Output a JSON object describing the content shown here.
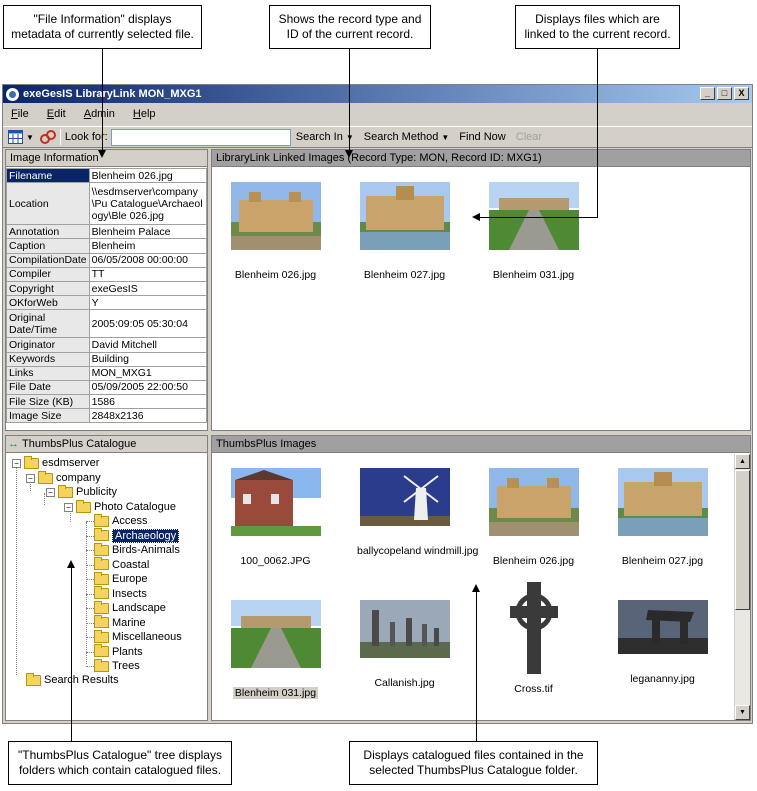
{
  "callouts": {
    "file_info": "\"File Information\" displays metadata of currently selected file.",
    "record_type": "Shows the record type and ID of the current record.",
    "linked_files": "Displays files which are linked to the current record.",
    "catalogue_tree": "\"ThumbsPlus Catalogue\" tree displays folders which contain catalogued files.",
    "catalogued_files": "Displays catalogued files contained in the selected ThumbsPlus Catalogue folder."
  },
  "window": {
    "title": "exeGesIS LibraryLink MON_MXG1",
    "buttons": [
      "_",
      "□",
      "X"
    ]
  },
  "menu": [
    "File",
    "Edit",
    "Admin",
    "Help"
  ],
  "toolbar": {
    "look_for_label": "Look for:",
    "look_for_value": "",
    "search_in": "Search In",
    "search_method": "Search Method",
    "find_now": "Find Now",
    "clear": "Clear"
  },
  "image_info": {
    "header": "Image Information",
    "rows": [
      {
        "key": "Filename",
        "value": "Blenheim 026.jpg"
      },
      {
        "key": "Location",
        "value": "\\\\esdmserver\\company\\Pu Catalogue\\Archaeology\\Ble 026.jpg"
      },
      {
        "key": "Annotation",
        "value": "Blenheim Palace"
      },
      {
        "key": "Caption",
        "value": "Blenheim"
      },
      {
        "key": "CompilationDate",
        "value": "06/05/2008 00:00:00"
      },
      {
        "key": "Compiler",
        "value": "TT"
      },
      {
        "key": "Copyright",
        "value": "exeGesIS"
      },
      {
        "key": "OKforWeb",
        "value": "Y"
      },
      {
        "key": "Original Date/Time",
        "value": "2005:09:05 05:30:04"
      },
      {
        "key": "Originator",
        "value": "David Mitchell"
      },
      {
        "key": "Keywords",
        "value": "Building"
      },
      {
        "key": "Links",
        "value": "MON_MXG1"
      },
      {
        "key": "File Date",
        "value": "05/09/2005 22:00:50"
      },
      {
        "key": "File Size (KB)",
        "value": "1586"
      },
      {
        "key": "Image Size",
        "value": "2848x2136"
      }
    ]
  },
  "linked_images": {
    "header": "LibraryLink Linked Images (Record Type: MON, Record ID: MXG1)",
    "items": [
      "Blenheim 026.jpg",
      "Blenheim 027.jpg",
      "Blenheim 031.jpg"
    ]
  },
  "catalogue": {
    "header": "ThumbsPlus Catalogue",
    "tree": {
      "esdmserver": "esdmserver",
      "company": "company",
      "publicity": "Publicity",
      "photo_catalogue": "Photo Catalogue",
      "folders": [
        "Access",
        "Archaeology",
        "Birds-Animals",
        "Coastal",
        "Europe",
        "Insects",
        "Landscape",
        "Marine",
        "Miscellaneous",
        "Plants",
        "Trees"
      ],
      "search_results": "Search Results"
    }
  },
  "thumbs_images": {
    "header": "ThumbsPlus Images",
    "items": [
      "100_0062.JPG",
      "ballycopeland windmill.jpg",
      "Blenheim 026.jpg",
      "Blenheim 027.jpg",
      "Blenheim 031.jpg",
      "Callanish.jpg",
      "Cross.tif",
      "legananny.jpg"
    ]
  }
}
